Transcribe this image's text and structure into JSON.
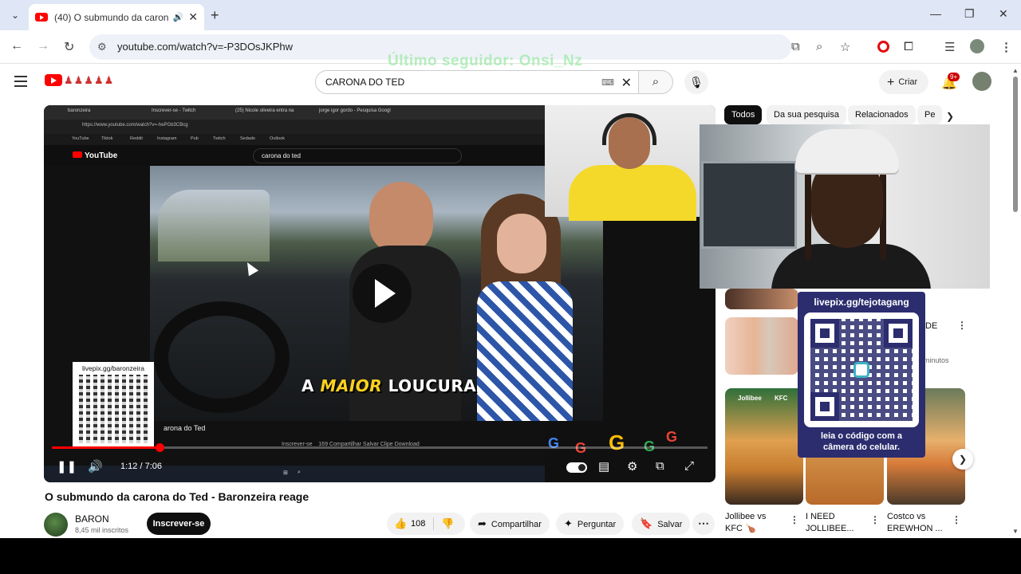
{
  "browser": {
    "tab_title": "(40) O submundo da carona",
    "new_tab_symbol": "+",
    "url": "youtube.com/watch?v=-P3DOsJKPhw"
  },
  "stream_overlay": {
    "last_follower": "Último seguidor: Onsi_Nz",
    "qr_left_label": "livepix.gg/baronzeira",
    "qr_right_label": "livepix.gg/tejotagang",
    "qr_right_caption_line1": "leia o código com a",
    "qr_right_caption_line2": "câmera do celular."
  },
  "youtube": {
    "search_query": "CARONA DO TED",
    "create_label": "Criar",
    "notif_badge": "9+"
  },
  "player": {
    "inner_tabs": [
      "baronzeira",
      "Inscrever-se - Twitch",
      "(25) Nicole oliveira entra na",
      "jorge igor gordo - Pesquisa Googl"
    ],
    "inner_url": "https://www.youtube.com/watch?v=-hePGb3CBcg",
    "inner_bookmarks": [
      "YouTube",
      "Tiktok",
      "Reddit",
      "Instagram",
      "Pub",
      "Twitch",
      "Sedado",
      "Outlook"
    ],
    "inner_search": "carona do ted",
    "inner_yt_logo": "YouTube",
    "inner_channel_text": "arona do Ted",
    "inner_actions": "Inscrever-se      169   Compartilhar   Salvar   Clipe   Download",
    "caption_prefix": "A ",
    "caption_highlight": "MAIOR",
    "caption_suffix": " LOUCURA",
    "time": "1:12 / 7:06",
    "progress": 0.164
  },
  "video": {
    "title": "O submundo da carona do Ted - Baronzeira reage",
    "channel": "BARON",
    "subscribers": "8,45 mil inscritos",
    "subscribe_label": "Inscrever-se",
    "likes": "108",
    "share_label": "Compartilhar",
    "ask_label": "Perguntar",
    "save_label": "Salvar"
  },
  "sidebar": {
    "chips": [
      "Todos",
      "Da sua pesquisa",
      "Relacionados",
      "Pe"
    ],
    "partial_texts": [
      "DE",
      "minutos"
    ],
    "recs": [
      {
        "title_line1": "Jollibee vs",
        "title_line2": "KFC 🍗",
        "brand_a": "Jollibee",
        "brand_b": "KFC"
      },
      {
        "title_line1": "I NEED",
        "title_line2": "JOLLIBEE..."
      },
      {
        "title_line1": "Costco vs",
        "title_line2": "EREWHON ..."
      }
    ]
  }
}
